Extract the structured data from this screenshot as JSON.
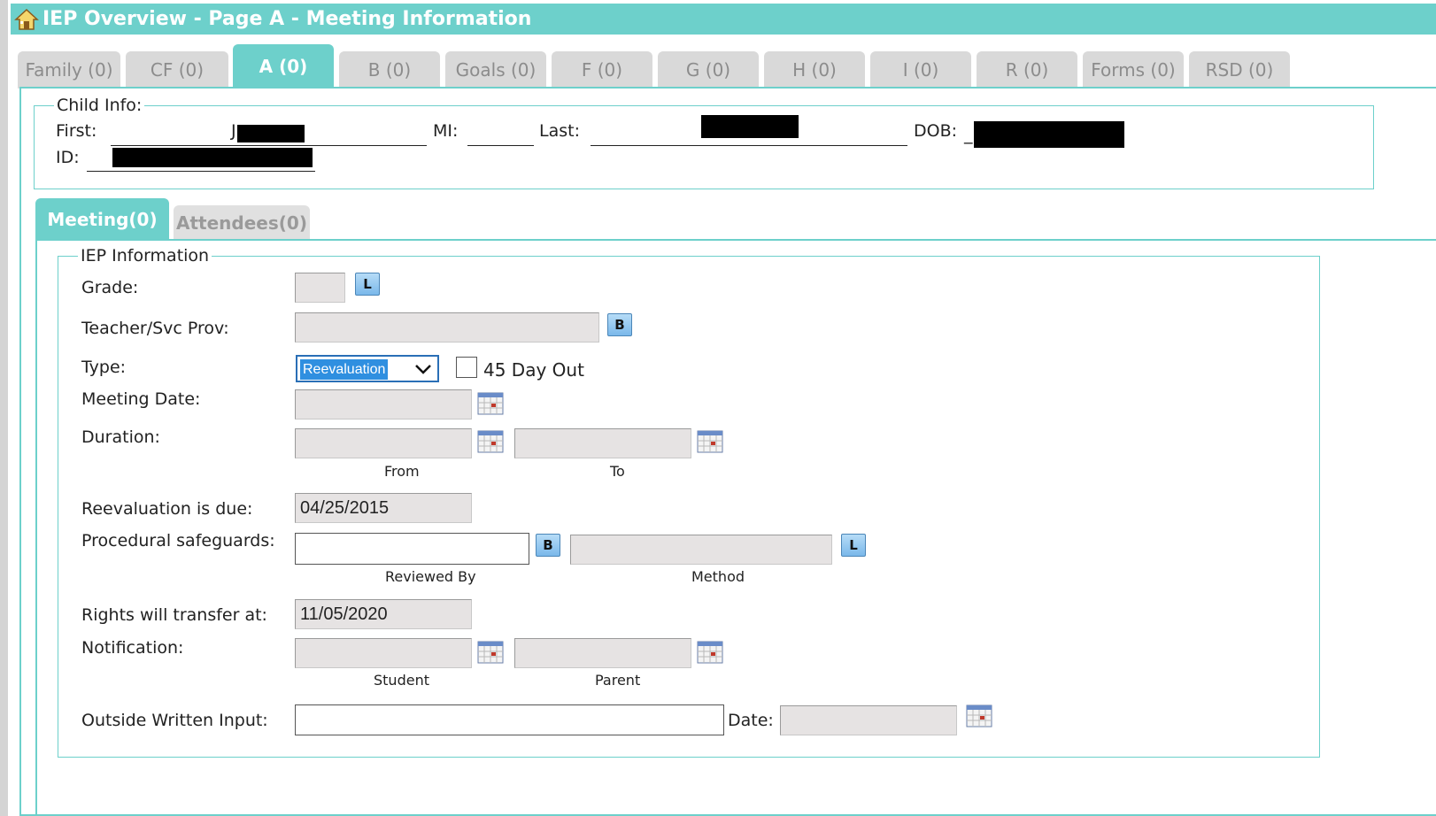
{
  "window": {
    "title": "IEP Overview - Page A - Meeting Information"
  },
  "tabs": [
    {
      "label": "Family (0)"
    },
    {
      "label": "CF (0)"
    },
    {
      "label": "A (0)",
      "active": true
    },
    {
      "label": "B (0)"
    },
    {
      "label": "Goals (0)"
    },
    {
      "label": "F (0)"
    },
    {
      "label": "G (0)"
    },
    {
      "label": "H (0)"
    },
    {
      "label": "I (0)"
    },
    {
      "label": "R (0)"
    },
    {
      "label": "Forms (0)"
    },
    {
      "label": "RSD (0)"
    }
  ],
  "child_info": {
    "legend": "Child Info:",
    "first_label": "First:",
    "first_value": "J",
    "mi_label": "MI:",
    "last_label": "Last:",
    "dob_label": "DOB:",
    "dob_prefix": "_",
    "id_label": "ID:"
  },
  "subtabs": [
    {
      "label": "Meeting(0)",
      "active": true
    },
    {
      "label": "Attendees(0)"
    }
  ],
  "iep": {
    "legend": "IEP Information",
    "grade_label": "Grade:",
    "grade_button": "L",
    "teacher_label": "Teacher/Svc Prov:",
    "teacher_button": "B",
    "type_label": "Type:",
    "type_selected": "Reevaluation",
    "day_out_label": "45 Day Out",
    "meeting_date_label": "Meeting Date:",
    "duration_label": "Duration:",
    "from_label": "From",
    "to_label": "To",
    "reeval_label": "Reevaluation is due:",
    "reeval_value": "04/25/2015",
    "safeguards_label": "Procedural safeguards:",
    "safeguards_button_b": "B",
    "safeguards_button_l": "L",
    "reviewed_by_label": "Reviewed By",
    "method_label": "Method",
    "rights_label": "Rights will transfer at:",
    "rights_value": "11/05/2020",
    "notification_label": "Notification:",
    "student_label": "Student",
    "parent_label": "Parent",
    "outside_label": "Outside Written Input:",
    "date_label": "Date:"
  },
  "colors": {
    "accent": "#6dd0cb",
    "field_bg": "#e6e3e3",
    "button_blue": "#7ab8ea"
  },
  "icons": {
    "title": "home-icon",
    "date_picker": "calendar-icon",
    "dropdown": "chevron-down-icon"
  }
}
